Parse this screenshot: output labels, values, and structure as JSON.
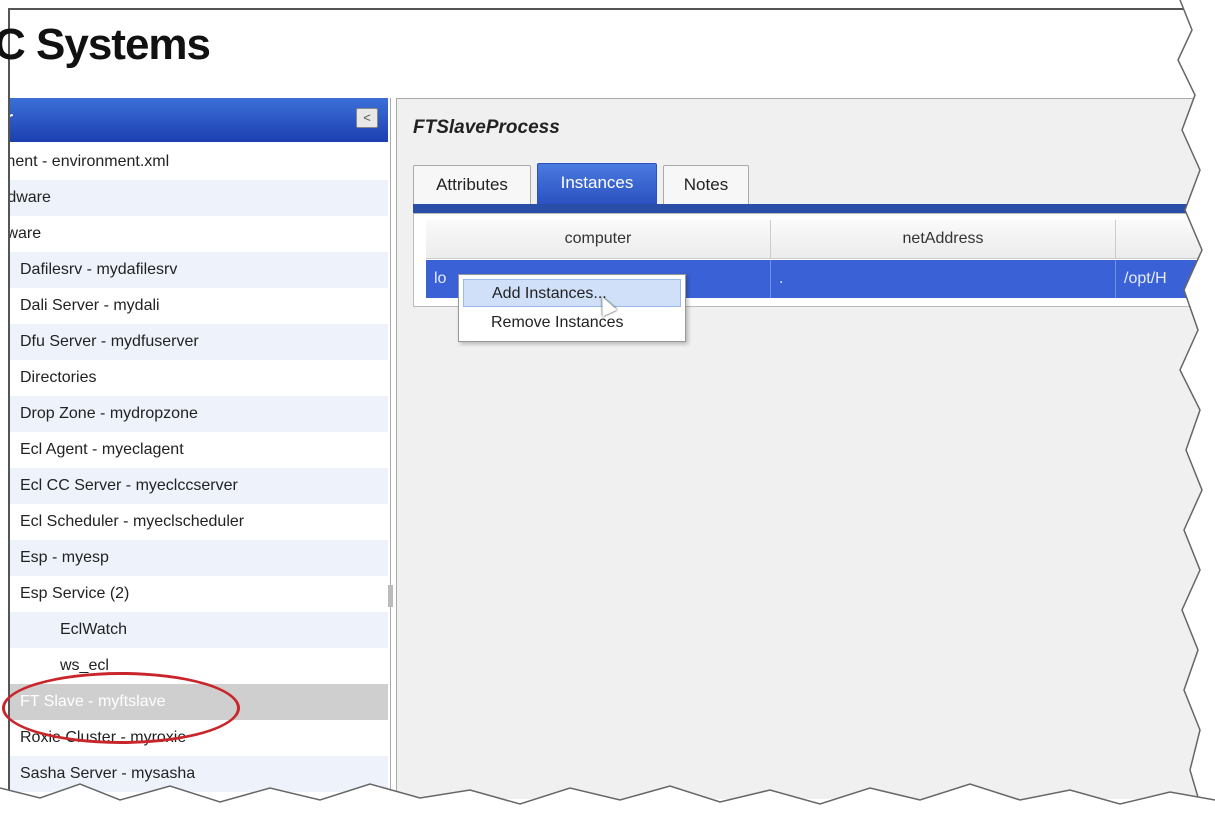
{
  "brand": {
    "text": "C Systems"
  },
  "left_panel": {
    "header_title": "r",
    "collapse_glyph": "<",
    "items": [
      {
        "label": "ment - environment.xml",
        "level": 0
      },
      {
        "label": "rdware",
        "level": 0
      },
      {
        "label": "tware",
        "level": 0
      },
      {
        "label": "Dafilesrv - mydafilesrv",
        "level": 1
      },
      {
        "label": "Dali Server - mydali",
        "level": 1
      },
      {
        "label": "Dfu Server - mydfuserver",
        "level": 1
      },
      {
        "label": "Directories",
        "level": 1
      },
      {
        "label": "Drop Zone - mydropzone",
        "level": 1
      },
      {
        "label": "Ecl Agent - myeclagent",
        "level": 1
      },
      {
        "label": "Ecl CC Server - myeclccserver",
        "level": 1
      },
      {
        "label": "Ecl Scheduler - myeclscheduler",
        "level": 1
      },
      {
        "label": "Esp - myesp",
        "level": 1
      },
      {
        "label": "Esp Service (2)",
        "level": 1
      },
      {
        "label": "EclWatch",
        "level": 2
      },
      {
        "label": "ws_ecl",
        "level": 2
      },
      {
        "label": "FT Slave - myftslave",
        "level": 1,
        "selected": true
      },
      {
        "label": "Roxie Cluster - myroxie",
        "level": 1
      },
      {
        "label": "Sasha Server - mysasha",
        "level": 1
      }
    ]
  },
  "main": {
    "title": "FTSlaveProcess",
    "tabs": [
      {
        "label": "Attributes"
      },
      {
        "label": "Instances",
        "active": true
      },
      {
        "label": "Notes"
      }
    ],
    "grid": {
      "columns": [
        "computer",
        "netAddress",
        ""
      ],
      "row": [
        "lo",
        ".",
        "/opt/H"
      ]
    }
  },
  "context_menu": {
    "items": [
      {
        "label": "Add Instances...",
        "hover": true
      },
      {
        "label": "Remove Instances"
      }
    ]
  },
  "colors": {
    "header_blue": "#1c3fb0",
    "active_tab": "#2b52c0",
    "selected_row": "#3a62d6",
    "highlight_ellipse": "#c8262a"
  }
}
